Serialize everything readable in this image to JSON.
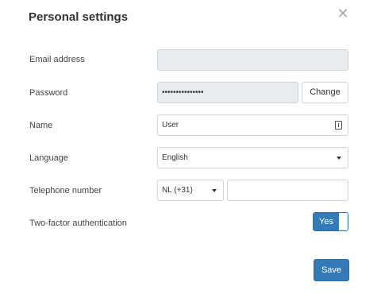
{
  "dialog": {
    "title": "Personal settings",
    "close_icon": "close-icon"
  },
  "form": {
    "email": {
      "label": "Email address",
      "value": ""
    },
    "password": {
      "label": "Password",
      "value": "•••••••••••••••",
      "change_label": "Change"
    },
    "name": {
      "label": "Name",
      "value": "User",
      "icon": "contact-card-icon"
    },
    "language": {
      "label": "Language",
      "value": "English"
    },
    "telephone": {
      "label": "Telephone number",
      "country_code": "NL (+31)",
      "number": ""
    },
    "two_factor": {
      "label": "Two-factor authentication",
      "toggle_label": "Yes",
      "enabled": true
    }
  },
  "footer": {
    "save_label": "Save"
  },
  "colors": {
    "primary": "#337ab7",
    "disabled_bg": "#e9ecef",
    "close": "#aaaaaa"
  }
}
